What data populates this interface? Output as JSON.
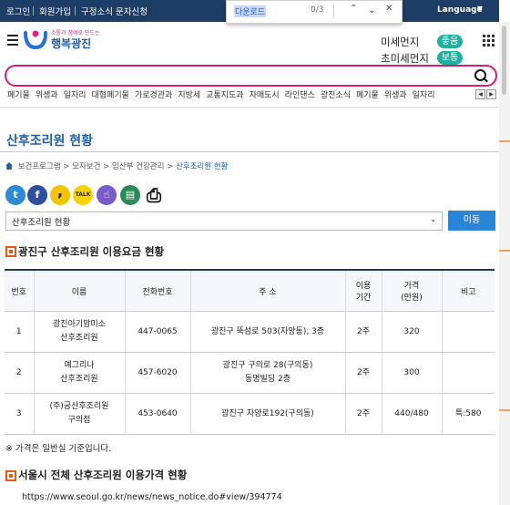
{
  "topbar": {
    "links": [
      "로그인",
      "회원가입",
      "구정소식 문자신청"
    ],
    "language_label": "Language"
  },
  "find_popup": {
    "query": "다운로드",
    "count": "0/3"
  },
  "header": {
    "logo_tagline": "소통과 참여로 만드는",
    "logo_text": "행복광진",
    "dust": [
      {
        "label": "미세먼지",
        "status": "좋음"
      },
      {
        "label": "초미세먼지",
        "status": "보통"
      }
    ],
    "search_placeholder": ""
  },
  "keywords": [
    "폐기물",
    "위생과",
    "일자리",
    "대형폐기물",
    "가로경관과",
    "지방세",
    "교통지도과",
    "자매도시",
    "라인댄스",
    "광진소식",
    "폐기물",
    "위생과",
    "일자리"
  ],
  "page": {
    "title": "산후조리원 현황",
    "breadcrumb": [
      "보건프로그램",
      "모자보건",
      "임산부 건강관리",
      "산후조리원 현황"
    ],
    "select_value": "산후조리원 현황",
    "go_label": "이동"
  },
  "share_icons": [
    {
      "name": "twitter-icon",
      "glyph": "t",
      "color": "#2c8ad6"
    },
    {
      "name": "facebook-icon",
      "glyph": "f",
      "color": "#2e4f9c"
    },
    {
      "name": "kakaostory-icon",
      "glyph": ",",
      "color": "#f2c300"
    },
    {
      "name": "kakaotalk-icon",
      "glyph": "TALK",
      "color": "#f6d400"
    },
    {
      "name": "band-icon",
      "glyph": "☝",
      "color": "#7a5cc9"
    },
    {
      "name": "qr-icon",
      "glyph": "▤",
      "color": "#2a8a57"
    },
    {
      "name": "print-icon",
      "glyph": "⎙",
      "color": "#ffffff"
    }
  ],
  "section1": {
    "heading": "광진구 산후조리원 이용요금 현황",
    "columns": [
      "번호",
      "이름",
      "전화번호",
      "주 소",
      "이용\n기간",
      "가격\n(만원)",
      "비고"
    ],
    "rows": [
      [
        "1",
        "광진아기맘미소\n산후조리원",
        "447-0065",
        "광진구 뚝섬로 503(자양동), 3층",
        "2주",
        "320",
        ""
      ],
      [
        "2",
        "예그리나\n산후조리원",
        "457-6020",
        "광진구 구의로 28(구의동)\n동명빌딩 2층",
        "2주",
        "300",
        ""
      ],
      [
        "3",
        "(주)궁산후조리원\n구의점",
        "453-0640",
        "광진구 자양로192(구의동)",
        "2주",
        "440/480",
        "특:580"
      ]
    ],
    "note": "※ 가격은 일반실 기준입니다."
  },
  "section2": {
    "heading": "서울시 전체 산후조리원 이용가격 현황",
    "url": "https://www.seoul.go.kr/news/news_notice.do#view/394774"
  },
  "colors": {
    "topbar": "#1c3d66",
    "accent": "#1f5fa8",
    "search_border": "#d8206e",
    "badge": "#1eb0a0",
    "section_mark": "#e7580d",
    "go_button": "#2b85d6"
  }
}
